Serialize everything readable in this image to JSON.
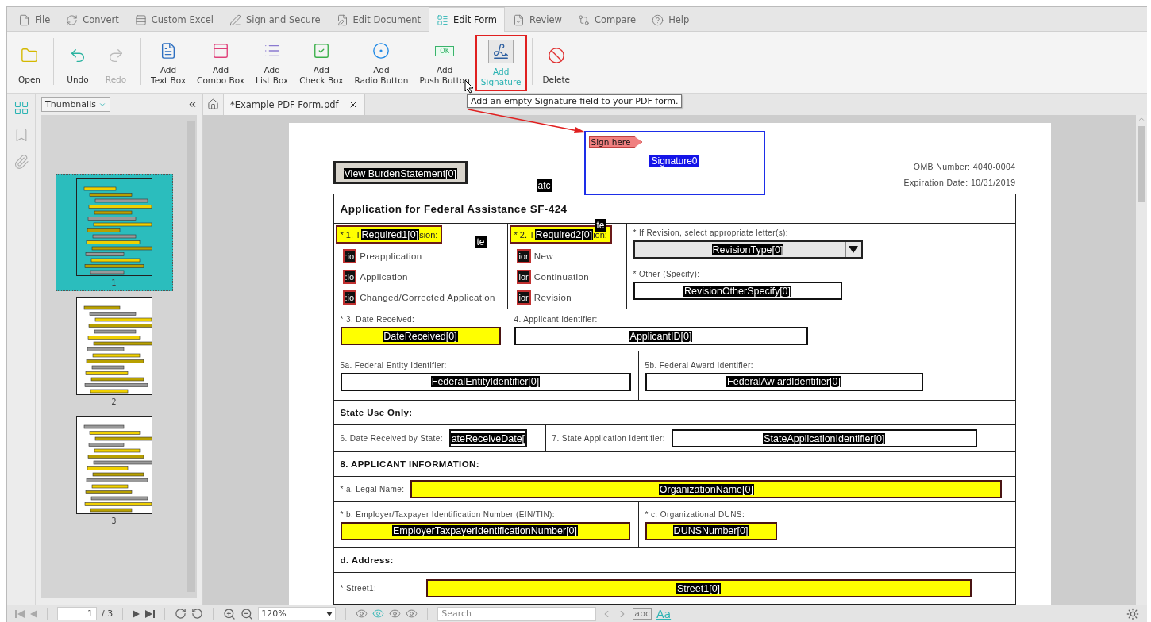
{
  "menu_tabs": [
    {
      "label": "File",
      "selected": false
    },
    {
      "label": "Convert",
      "selected": false
    },
    {
      "label": "Custom Excel",
      "selected": false
    },
    {
      "label": "Sign and Secure",
      "selected": false
    },
    {
      "label": "Edit Document",
      "selected": false
    },
    {
      "label": "Edit Form",
      "selected": true
    },
    {
      "label": "Review",
      "selected": false
    },
    {
      "label": "Compare",
      "selected": false
    },
    {
      "label": "Help",
      "selected": false
    }
  ],
  "ribbon": [
    {
      "label": "Open",
      "disabled": false,
      "selected": false
    },
    {
      "label": "Undo",
      "disabled": false,
      "selected": false
    },
    {
      "label": "Redo",
      "disabled": true,
      "selected": false
    },
    {
      "label": "Add\nText Box",
      "disabled": false,
      "selected": false
    },
    {
      "label": "Add\nCombo Box",
      "disabled": false,
      "selected": false
    },
    {
      "label": "Add\nList Box",
      "disabled": false,
      "selected": false
    },
    {
      "label": "Add\nCheck Box",
      "disabled": false,
      "selected": false
    },
    {
      "label": "Add\nRadio Button",
      "disabled": false,
      "selected": false
    },
    {
      "label": "Add\nPush Button",
      "disabled": false,
      "selected": false,
      "badge": "OK"
    },
    {
      "label": "Add\nSignature",
      "disabled": false,
      "selected": true
    },
    {
      "label": "Delete",
      "disabled": false,
      "selected": false
    }
  ],
  "tooltip": "Add an empty Signature field to your PDF form.",
  "side_panel": {
    "view": "Thumbnails",
    "thumbnails": [
      {
        "label": "1",
        "selected": true
      },
      {
        "label": "2",
        "selected": false
      },
      {
        "label": "3",
        "selected": false
      }
    ]
  },
  "document_tab": {
    "title": "*Example PDF Form.pdf"
  },
  "page": {
    "signature": {
      "tag": "Sign here",
      "name": "Signature0"
    },
    "burden_button": "View BurdenStatement[0]",
    "stray_tags": [
      "atc",
      "te",
      "te"
    ],
    "omb_number": "OMB Number: 4040-0004",
    "expiration": "Expiration Date: 10/31/2019",
    "form_title": "Application for Federal Assistance SF-424",
    "type_groups": [
      {
        "prefix": "* 1. T",
        "name": "Required1[0]",
        "suffix": "sion:",
        "options": [
          {
            "tag": ":io",
            "label": "Preapplication"
          },
          {
            "tag": ":io",
            "label": "Application"
          },
          {
            "tag": ":io",
            "label": "Changed/Corrected Application"
          }
        ]
      },
      {
        "prefix": "* 2. T",
        "name": "Required2[0]",
        "suffix": "ion:",
        "options": [
          {
            "tag": "ior",
            "label": "New"
          },
          {
            "tag": "ior",
            "label": "Continuation"
          },
          {
            "tag": "ior",
            "label": "Revision"
          }
        ]
      }
    ],
    "revision": {
      "label": "* If Revision, select appropriate letter(s):",
      "combo": "RevisionType[0]",
      "other_label": "* Other (Specify):",
      "other_field": "RevisionOtherSpecify[0]"
    },
    "rows": [
      {
        "kind": "stacked",
        "cells": [
          {
            "label": "* 3. Date Received:",
            "field": "DateReceived[0]",
            "required": true
          },
          {
            "label": "4. Applicant Identifier:",
            "field": "ApplicantID[0]",
            "required": false
          }
        ]
      },
      {
        "kind": "stacked",
        "cells": [
          {
            "label": "5a. Federal Entity Identifier:",
            "field": "FederalEntityIdentifier[0]",
            "required": false
          },
          {
            "label": "5b. Federal Award Identifier:",
            "field": "FederalAw ardIdentifier[0]",
            "required": false
          }
        ]
      },
      {
        "kind": "heading",
        "text": "State Use Only:"
      },
      {
        "kind": "inline",
        "cells": [
          {
            "label": "6. Date Received by State:",
            "field": "ateReceiveDate[",
            "required": false
          },
          {
            "label": "7. State Application Identifier:",
            "field": "StateApplicationIdentifier[0]",
            "required": false
          }
        ]
      },
      {
        "kind": "heading",
        "text": "8. APPLICANT INFORMATION:"
      },
      {
        "kind": "inline",
        "cells": [
          {
            "label": "* a. Legal Name:",
            "field": "OrganizationName[0]",
            "required": true
          }
        ]
      },
      {
        "kind": "stacked",
        "cells": [
          {
            "label": "* b. Employer/Taxpayer Identification Number (EIN/TIN):",
            "field": "EmployerTaxpayerIdentificationNumber[0]",
            "required": true
          },
          {
            "label": "* c. Organizational DUNS:",
            "field": "DUNSNumber[0]",
            "required": true
          }
        ]
      },
      {
        "kind": "heading",
        "text": "d. Address:"
      },
      {
        "kind": "inline",
        "cells": [
          {
            "label": "* Street1:",
            "field": "Street1[0]",
            "required": true
          }
        ]
      }
    ]
  },
  "status_bar": {
    "page": "1",
    "page_count": "/ 3",
    "zoom": "120%",
    "search_placeholder": "Search",
    "view_modes": [
      {
        "selected": false
      },
      {
        "selected": true
      },
      {
        "selected": false
      },
      {
        "selected": false
      }
    ],
    "text_buttons": [
      {
        "label": "abc",
        "selected": false
      },
      {
        "label": "Aa",
        "selected": true
      }
    ]
  }
}
